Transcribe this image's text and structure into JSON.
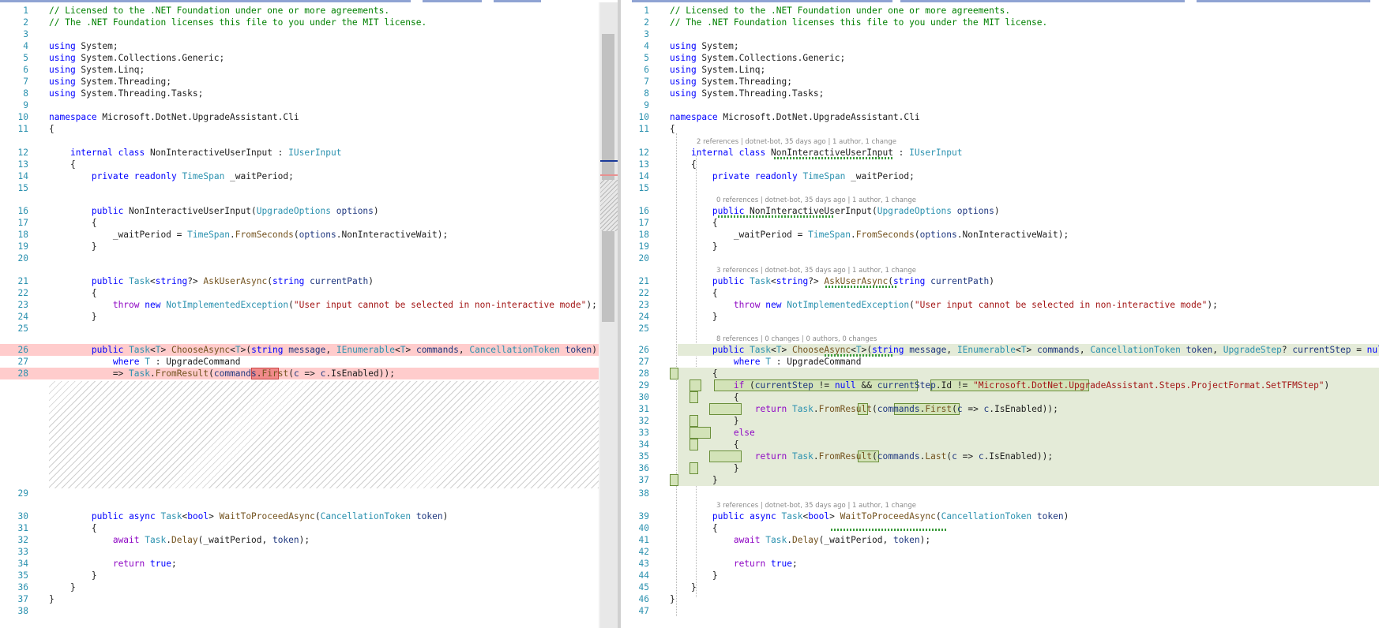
{
  "left_lines": [
    {
      "n": "1",
      "code": "// Licensed to the .NET Foundation under one or more agreements."
    },
    {
      "n": "2",
      "code": "// The .NET Foundation licenses this file to you under the MIT license."
    },
    {
      "n": "3",
      "code": ""
    },
    {
      "n": "4",
      "code": "using System;"
    },
    {
      "n": "5",
      "code": "using System.Collections.Generic;"
    },
    {
      "n": "6",
      "code": "using System.Linq;"
    },
    {
      "n": "7",
      "code": "using System.Threading;"
    },
    {
      "n": "8",
      "code": "using System.Threading.Tasks;"
    },
    {
      "n": "9",
      "code": ""
    },
    {
      "n": "10",
      "code": "namespace Microsoft.DotNet.UpgradeAssistant.Cli"
    },
    {
      "n": "11",
      "code": "{"
    },
    {
      "n": "12",
      "code": "    internal class NonInteractiveUserInput : IUserInput"
    },
    {
      "n": "13",
      "code": "    {"
    },
    {
      "n": "14",
      "code": "        private readonly TimeSpan _waitPeriod;"
    },
    {
      "n": "15",
      "code": ""
    },
    {
      "n": "16",
      "code": "        public NonInteractiveUserInput(UpgradeOptions options)"
    },
    {
      "n": "17",
      "code": "        {"
    },
    {
      "n": "18",
      "code": "            _waitPeriod = TimeSpan.FromSeconds(options.NonInteractiveWait);"
    },
    {
      "n": "19",
      "code": "        }"
    },
    {
      "n": "20",
      "code": ""
    },
    {
      "n": "21",
      "code": "        public Task<string?> AskUserAsync(string currentPath)"
    },
    {
      "n": "22",
      "code": "        {"
    },
    {
      "n": "23",
      "code": "            throw new NotImplementedException(\"User input cannot be selected in non-interactive mode\");"
    },
    {
      "n": "24",
      "code": "        }"
    },
    {
      "n": "25",
      "code": ""
    },
    {
      "n": "26",
      "code": "        public Task<T> ChooseAsync<T>(string message, IEnumerable<T> commands, CancellationToken token)"
    },
    {
      "n": "27",
      "code": "            where T : UpgradeCommand"
    },
    {
      "n": "28",
      "code": "            => Task.FromResult(commands.First(c => c.IsEnabled));"
    },
    {
      "n": "29",
      "code": ""
    },
    {
      "n": "30",
      "code": "        public async Task<bool> WaitToProceedAsync(CancellationToken token)"
    },
    {
      "n": "31",
      "code": "        {"
    },
    {
      "n": "32",
      "code": "            await Task.Delay(_waitPeriod, token);"
    },
    {
      "n": "33",
      "code": ""
    },
    {
      "n": "34",
      "code": "            return true;"
    },
    {
      "n": "35",
      "code": "        }"
    },
    {
      "n": "36",
      "code": "    }"
    },
    {
      "n": "37",
      "code": "}"
    },
    {
      "n": "38",
      "code": ""
    }
  ],
  "right_lines": [
    {
      "n": "1",
      "code": "// Licensed to the .NET Foundation under one or more agreements."
    },
    {
      "n": "2",
      "code": "// The .NET Foundation licenses this file to you under the MIT license."
    },
    {
      "n": "3",
      "code": ""
    },
    {
      "n": "4",
      "code": "using System;"
    },
    {
      "n": "5",
      "code": "using System.Collections.Generic;"
    },
    {
      "n": "6",
      "code": "using System.Linq;"
    },
    {
      "n": "7",
      "code": "using System.Threading;"
    },
    {
      "n": "8",
      "code": "using System.Threading.Tasks;"
    },
    {
      "n": "9",
      "code": ""
    },
    {
      "n": "10",
      "code": "namespace Microsoft.DotNet.UpgradeAssistant.Cli"
    },
    {
      "n": "11",
      "code": "{"
    },
    {
      "n": "12",
      "code": "    internal class NonInteractiveUserInput : IUserInput"
    },
    {
      "n": "13",
      "code": "    {"
    },
    {
      "n": "14",
      "code": "        private readonly TimeSpan _waitPeriod;"
    },
    {
      "n": "15",
      "code": ""
    },
    {
      "n": "16",
      "code": "        public NonInteractiveUserInput(UpgradeOptions options)"
    },
    {
      "n": "17",
      "code": "        {"
    },
    {
      "n": "18",
      "code": "            _waitPeriod = TimeSpan.FromSeconds(options.NonInteractiveWait);"
    },
    {
      "n": "19",
      "code": "        }"
    },
    {
      "n": "20",
      "code": ""
    },
    {
      "n": "21",
      "code": "        public Task<string?> AskUserAsync(string currentPath)"
    },
    {
      "n": "22",
      "code": "        {"
    },
    {
      "n": "23",
      "code": "            throw new NotImplementedException(\"User input cannot be selected in non-interactive mode\");"
    },
    {
      "n": "24",
      "code": "        }"
    },
    {
      "n": "25",
      "code": ""
    },
    {
      "n": "26",
      "code": "        public Task<T> ChooseAsync<T>(string message, IEnumerable<T> commands, CancellationToken token, UpgradeStep? currentStep = null)"
    },
    {
      "n": "27",
      "code": "            where T : UpgradeCommand"
    },
    {
      "n": "28",
      "code": "        {"
    },
    {
      "n": "29",
      "code": "            if (currentStep != null && currentStep.Id != \"Microsoft.DotNet.UpgradeAssistant.Steps.ProjectFormat.SetTFMStep\")"
    },
    {
      "n": "30",
      "code": "            {"
    },
    {
      "n": "31",
      "code": "                return Task.FromResult(commands.First(c => c.IsEnabled));"
    },
    {
      "n": "32",
      "code": "            }"
    },
    {
      "n": "33",
      "code": "            else"
    },
    {
      "n": "34",
      "code": "            {"
    },
    {
      "n": "35",
      "code": "                return Task.FromResult(commands.Last(c => c.IsEnabled));"
    },
    {
      "n": "36",
      "code": "            }"
    },
    {
      "n": "37",
      "code": "        }"
    },
    {
      "n": "38",
      "code": ""
    },
    {
      "n": "39",
      "code": "        public async Task<bool> WaitToProceedAsync(CancellationToken token)"
    },
    {
      "n": "40",
      "code": "        {"
    },
    {
      "n": "41",
      "code": "            await Task.Delay(_waitPeriod, token);"
    },
    {
      "n": "42",
      "code": ""
    },
    {
      "n": "43",
      "code": "            return true;"
    },
    {
      "n": "44",
      "code": "        }"
    },
    {
      "n": "45",
      "code": "    }"
    },
    {
      "n": "46",
      "code": "}"
    },
    {
      "n": "47",
      "code": ""
    }
  ],
  "codelens": {
    "class12": "2 references | dotnet-bot, 35 days ago | 1 author, 1 change",
    "ctor16": "0 references | dotnet-bot, 35 days ago | 1 author, 1 change",
    "ask21": "3 references | dotnet-bot, 35 days ago | 1 author, 1 change",
    "choose26": "8 references | 0 changes | 0 authors, 0 changes",
    "wait39": "3 references | dotnet-bot, 35 days ago | 1 author, 1 change"
  },
  "colors": {
    "deleted_line": "#ffcccc",
    "deleted_word": "#f08a8a",
    "added_block": "#e4ebd8",
    "added_word": "#d3e3b8",
    "line_number": "#2b91af",
    "keyword": "#0000ff",
    "type": "#2b91af",
    "string": "#a31515",
    "comment": "#008000"
  }
}
